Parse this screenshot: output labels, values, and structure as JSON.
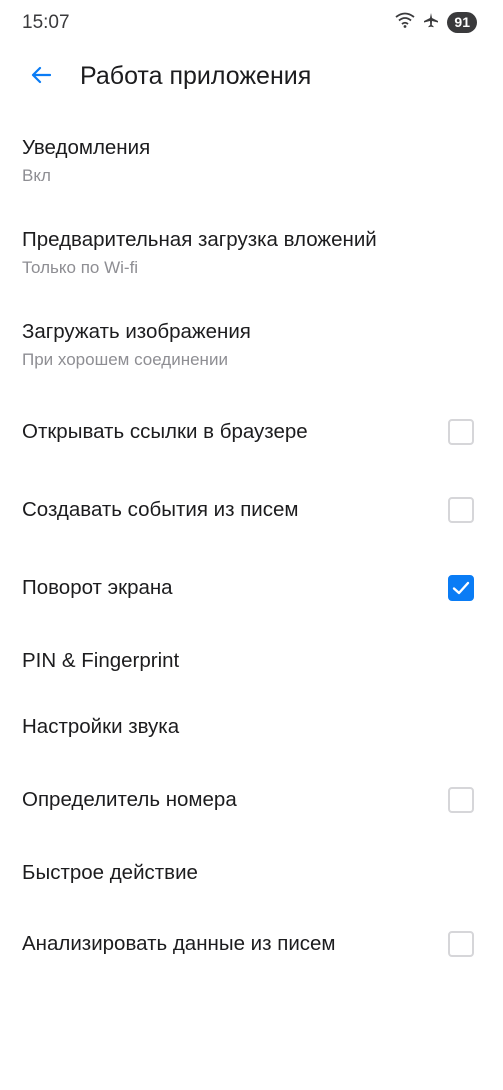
{
  "status_bar": {
    "time": "15:07",
    "battery": "91",
    "icons": [
      "wifi-icon",
      "airplane-icon",
      "battery-icon"
    ]
  },
  "app_bar": {
    "title": "Работа приложения",
    "back_icon": "arrow-left-icon"
  },
  "colors": {
    "accent": "#0a7cf5",
    "text_primary": "#1c1c1e",
    "text_secondary": "#8e8e93"
  },
  "settings": {
    "notifications": {
      "title": "Уведомления",
      "subtitle": "Вкл"
    },
    "preload_attachments": {
      "title": "Предварительная загрузка вложений",
      "subtitle": "Только по Wi-fi"
    },
    "load_images": {
      "title": "Загружать изображения",
      "subtitle": "При хорошем соединении"
    },
    "open_links_browser": {
      "title": "Открывать ссылки в браузере",
      "checked": false
    },
    "create_events": {
      "title": "Создавать события из писем",
      "checked": false
    },
    "screen_rotation": {
      "title": "Поворот экрана",
      "checked": true
    },
    "pin_fingerprint": {
      "title": "PIN & Fingerprint"
    },
    "sound_settings": {
      "title": "Настройки звука"
    },
    "caller_id": {
      "title": "Определитель номера",
      "checked": false
    },
    "quick_action": {
      "title": "Быстрое действие"
    },
    "analyze_data": {
      "title": "Анализировать данные из писем",
      "checked": false
    }
  }
}
